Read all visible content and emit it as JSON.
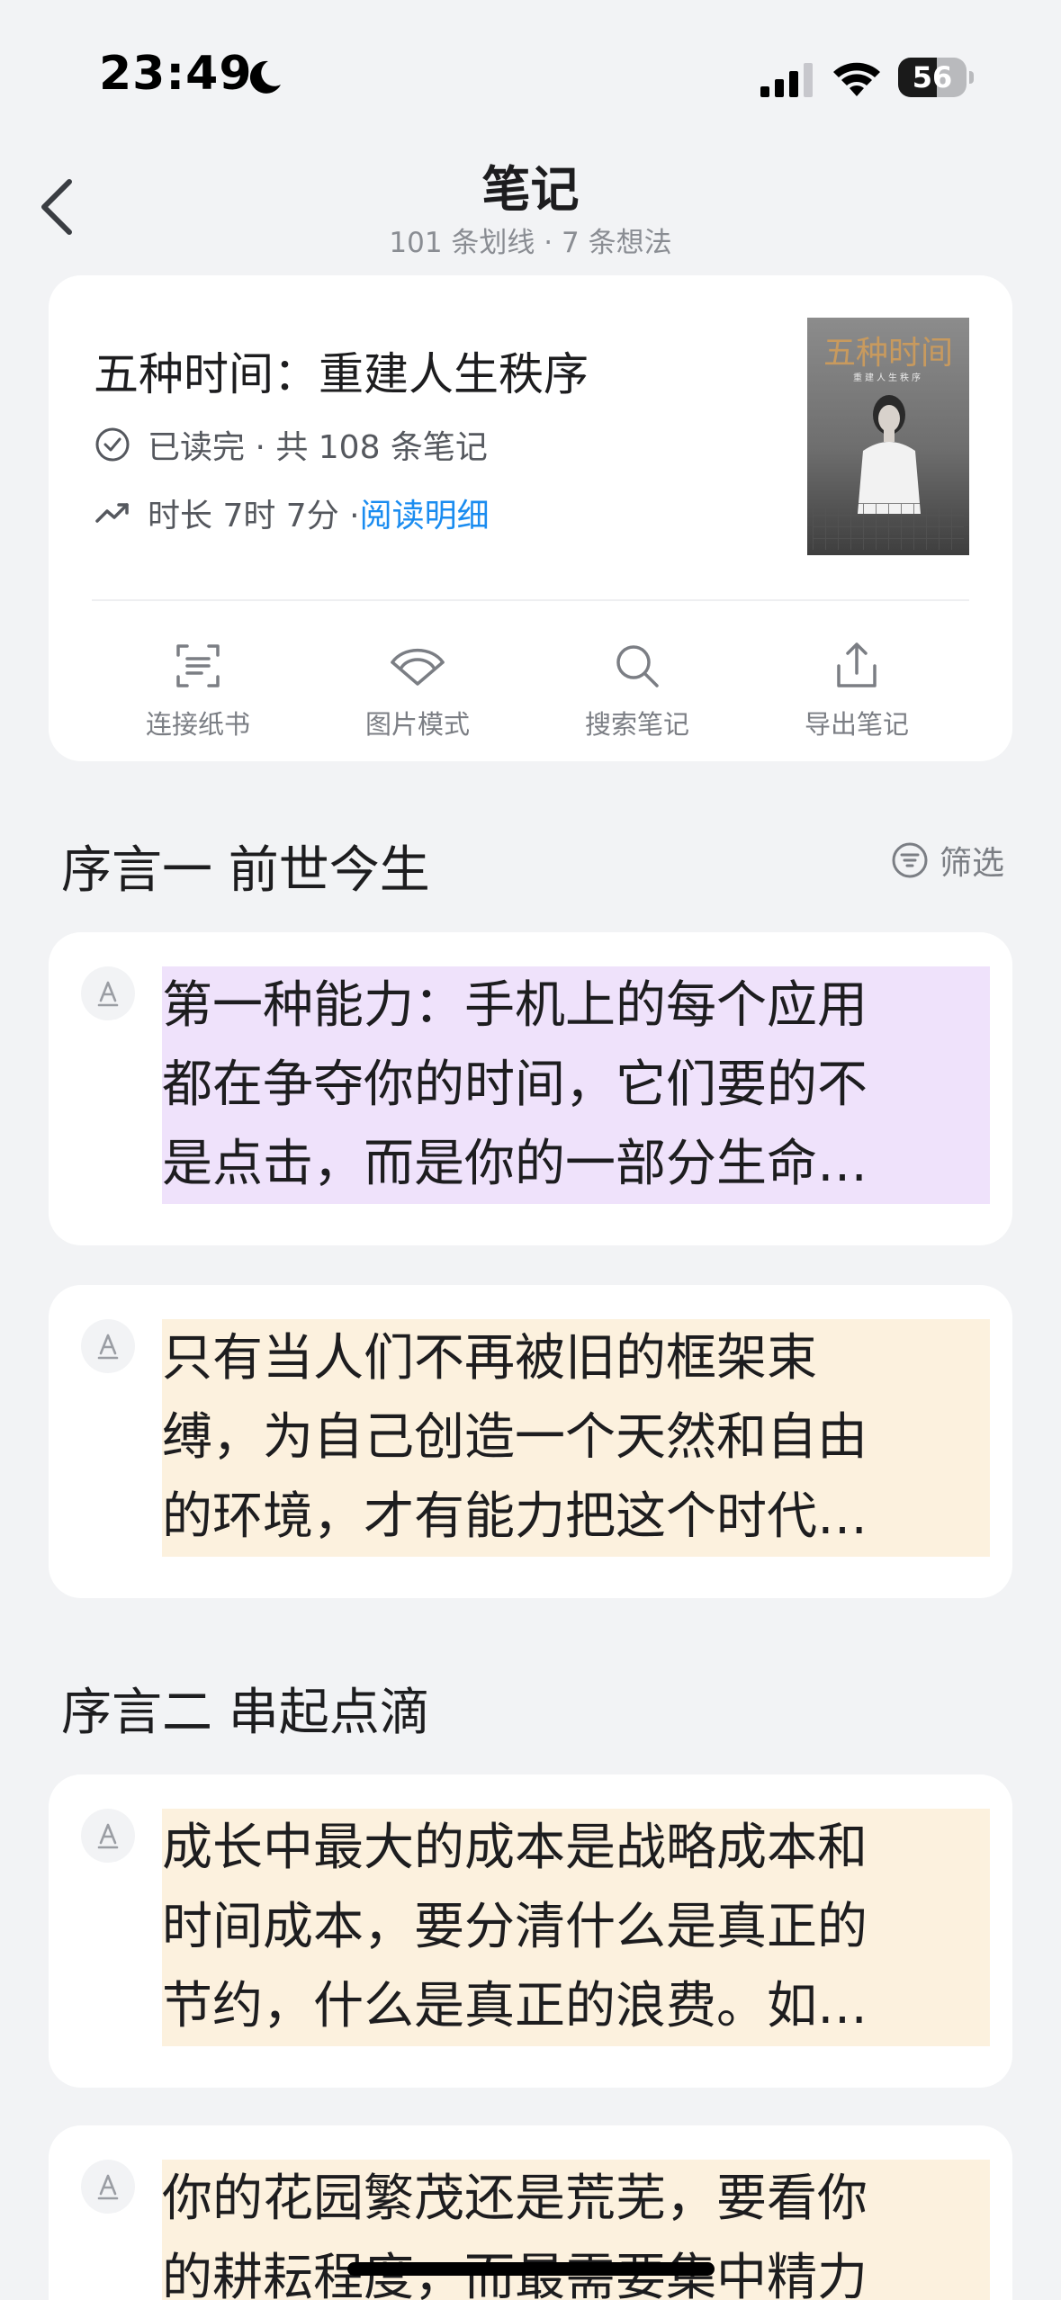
{
  "status_bar": {
    "time": "23:49",
    "battery_level": "56",
    "battery_fraction": 0.56
  },
  "header": {
    "title": "笔记",
    "subtitle": "101 条划线 · 7 条想法"
  },
  "book": {
    "title": "五种时间：重建人生秩序",
    "status": "已读完 · 共 108 条笔记",
    "duration_prefix": "时长 7时 7分 · ",
    "detail_link": "阅读明细",
    "cover_title": "五种时间",
    "cover_subtitle": "重建人生秩序"
  },
  "actions": [
    {
      "label": "连接纸书",
      "icon": "scan-icon"
    },
    {
      "label": "图片模式",
      "icon": "image-mode-icon"
    },
    {
      "label": "搜索笔记",
      "icon": "search-icon"
    },
    {
      "label": "导出笔记",
      "icon": "export-icon"
    }
  ],
  "filter_label": "筛选",
  "sections": [
    {
      "title": "序言一 前世今生",
      "notes": [
        {
          "lines": [
            "第一种能力：手机上的每个应用",
            "都在争夺你的时间，它们要的不",
            "是点击，而是你的一部分生命…"
          ],
          "highlight": "purple"
        },
        {
          "lines": [
            "只有当人们不再被旧的框架束",
            "缚，为自己创造一个天然和自由",
            "的环境，才有能力把这个时代…"
          ],
          "highlight": "cream"
        }
      ]
    },
    {
      "title": "序言二 串起点滴",
      "notes": [
        {
          "lines": [
            "成长中最大的成本是战略成本和",
            "时间成本，要分清什么是真正的",
            "节约，什么是真正的浪费。如…"
          ],
          "highlight": "cream"
        },
        {
          "lines": [
            "你的花园繁茂还是荒芜，要看你",
            "的耕耘程度，而最需要集中精力",
            ""
          ],
          "highlight": "cream"
        }
      ]
    }
  ],
  "colors": {
    "background": "#f2f3f5",
    "link": "#1a8cf0",
    "highlight_purple": "#efe2fb",
    "highlight_cream": "#fcf1de"
  }
}
